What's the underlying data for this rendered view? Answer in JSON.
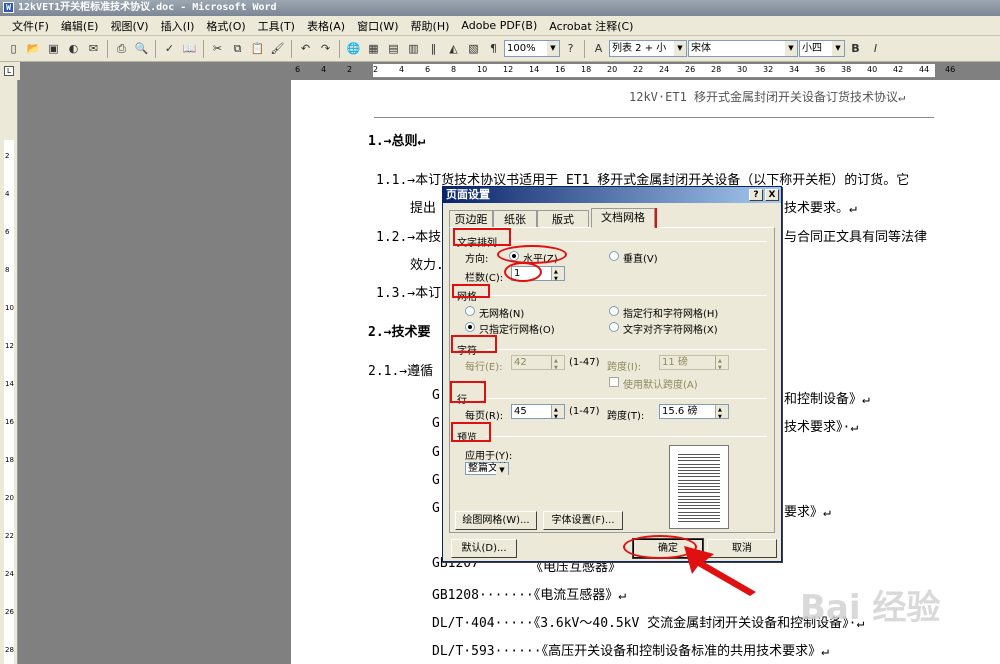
{
  "window": {
    "title": "12kVET1开关柜标准技术协议.doc - Microsoft Word"
  },
  "menu": [
    "文件(F)",
    "编辑(E)",
    "视图(V)",
    "插入(I)",
    "格式(O)",
    "工具(T)",
    "表格(A)",
    "窗口(W)",
    "帮助(H)",
    "Adobe PDF(B)",
    "Acrobat 注释(C)"
  ],
  "toolbar": {
    "zoom": "100%",
    "style": "列表 2 + 小",
    "font": "宋体",
    "size": "小四",
    "bold": "B",
    "italic": "I"
  },
  "ruler": {
    "numbers": [
      "6",
      "4",
      "2",
      "2",
      "4",
      "6",
      "8",
      "10",
      "12",
      "14",
      "16",
      "18",
      "20",
      "22",
      "24",
      "26",
      "28",
      "30",
      "32",
      "34",
      "36",
      "38",
      "40",
      "42",
      "44",
      "46"
    ]
  },
  "vruler": [
    "2",
    "4",
    "6",
    "8",
    "10",
    "12",
    "14",
    "16",
    "18",
    "20",
    "22",
    "24",
    "26",
    "28"
  ],
  "document": {
    "header": "12kV·ET1 移开式金属封闭开关设备订货技术协议↵",
    "s1": "1.→总则↵",
    "p11a": "1.1.→本订货技术协议书适用于 ET1 移开式金属封闭开关设备（以下称开关柜）的订货。它",
    "p11b": "提出",
    "p11c": "技术要求。↵",
    "p12a": "1.2.→本技",
    "p12b": "与合同正文具有同等法律",
    "p12c": "效力.",
    "p13": "1.3.→本订",
    "s2": "2.→技术要",
    "p21": "2.1.→遵循",
    "r1": "G",
    "r1b": "和控制设备》↵",
    "r2": "G",
    "r2b": "技术要求》·↵",
    "r3": "G",
    "r4": "G",
    "r5": "G",
    "r5b": "要求》↵",
    "r6": "GB1207",
    "r6b": "《电压互感器》",
    "r7": "GB1208·······《电流互感器》↵",
    "r8": "DL/T·404·····《3.6kV～40.5kV 交流金属封闭开关设备和控制设备》·↵",
    "r9": "DL/T·593······《高压开关设备和控制设备标准的共用技术要求》↵"
  },
  "dialog": {
    "title": "页面设置",
    "help_button": "?",
    "close_button": "X",
    "tabs": [
      "页边距",
      "纸张",
      "版式",
      "文档网格"
    ],
    "sec_text": "文字排列",
    "direction_label": "方向:",
    "dir_horizontal": "水平(Z)",
    "dir_vertical": "垂直(V)",
    "columns_label": "栏数(C):",
    "columns_value": "1",
    "sec_grid": "网格",
    "grid_none": "无网格(N)",
    "grid_line_char": "指定行和字符网格(H)",
    "grid_line_only": "只指定行网格(O)",
    "grid_snap_char": "文字对齐字符网格(X)",
    "sec_chars": "字符",
    "per_line_label": "每行(E):",
    "per_line_value": "42",
    "per_line_range": "(1-47)",
    "char_pitch_label": "跨度(I):",
    "char_pitch_value": "11 磅",
    "use_default_pitch": "使用默认跨度(A)",
    "sec_lines": "行",
    "per_page_label": "每页(R):",
    "per_page_value": "45",
    "per_page_range": "(1-47)",
    "line_pitch_label": "跨度(T):",
    "line_pitch_value": "15.6 磅",
    "sec_preview": "预览",
    "apply_label": "应用于(Y):",
    "apply_value": "整篇文档",
    "draw_grid": "绘图网格(W)...",
    "font_settings": "字体设置(F)...",
    "default": "默认(D)...",
    "ok": "确定",
    "cancel": "取消"
  },
  "watermark": "Bai 经验",
  "accent_colors": {
    "annotation": "#e01010",
    "title_bar": "#0a246a"
  }
}
